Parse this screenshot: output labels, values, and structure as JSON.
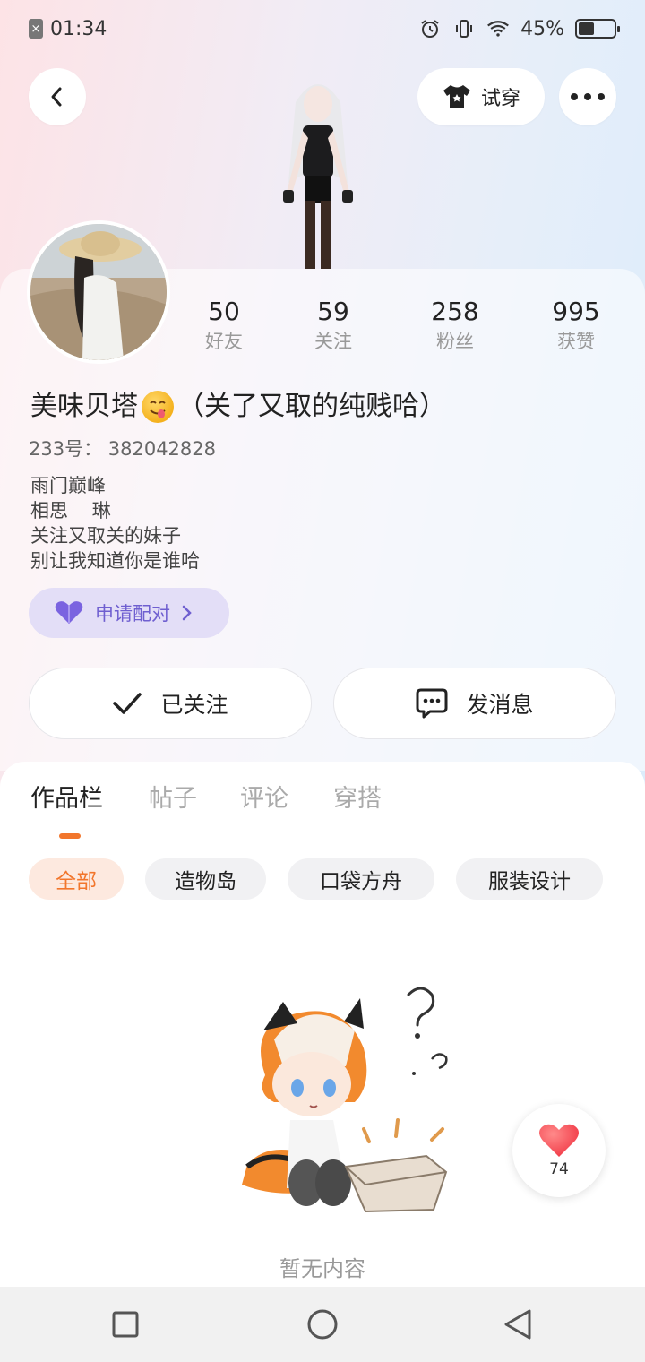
{
  "status_bar": {
    "time": "01:34",
    "battery_percent": "45%",
    "battery_level": 0.45
  },
  "top_bar": {
    "tryon_label": "试穿"
  },
  "profile": {
    "stats": [
      {
        "value": "50",
        "label": "好友"
      },
      {
        "value": "59",
        "label": "关注"
      },
      {
        "value": "258",
        "label": "粉丝"
      },
      {
        "value": "995",
        "label": "获赞"
      }
    ],
    "name_prefix": "美味贝塔",
    "name_suffix": "（关了又取的纯贱哈）",
    "uid": "233号：  382042828",
    "bio": "雨门巅峰\n相思    琳\n关注又取关的妹子\n别让我知道你是谁哈",
    "pair_label": "申请配对",
    "follow_label": "已关注",
    "message_label": "发消息"
  },
  "tabs": [
    "作品栏",
    "帖子",
    "评论",
    "穿搭"
  ],
  "filters": [
    "全部",
    "造物岛",
    "口袋方舟",
    "服装设计"
  ],
  "empty_text": "暂无内容",
  "like_count": "74",
  "colors": {
    "accent": "#f2762c",
    "pair_bg": "#e3def7",
    "pair_text": "#6f5fd0",
    "heart": "#f23f4b"
  }
}
